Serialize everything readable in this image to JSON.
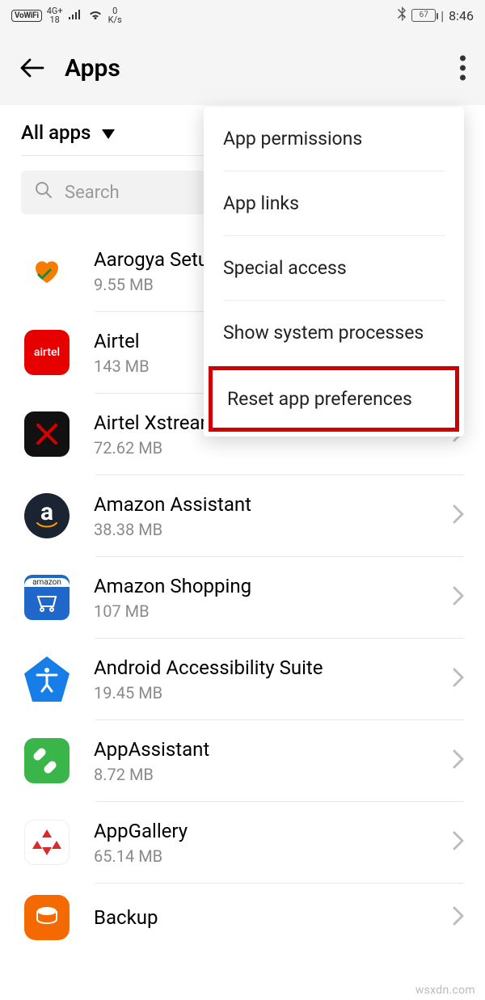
{
  "status": {
    "vowifi": "VoWiFi",
    "net_label": "4G+",
    "net_sub": "18",
    "speed_top": "0",
    "speed_unit": "K/s",
    "battery": "67",
    "time": "8:46"
  },
  "header": {
    "title": "Apps"
  },
  "filter": {
    "label": "All apps"
  },
  "search": {
    "placeholder": "Search"
  },
  "menu": {
    "items": [
      "App permissions",
      "App links",
      "Special access",
      "Show system processes",
      "Reset app preferences"
    ]
  },
  "apps": [
    {
      "name": "Aarogya Setu",
      "size": "9.55 MB",
      "icon": "aarogya-icon"
    },
    {
      "name": "Airtel",
      "size": "143 MB",
      "icon": "airtel-icon"
    },
    {
      "name": "Airtel Xstream",
      "size": "72.62 MB",
      "icon": "xstream-icon"
    },
    {
      "name": "Amazon Assistant",
      "size": "38.38 MB",
      "icon": "amazon-assistant-icon"
    },
    {
      "name": "Amazon Shopping",
      "size": "107 MB",
      "icon": "amazon-shopping-icon"
    },
    {
      "name": "Android Accessibility Suite",
      "size": "19.45 MB",
      "icon": "accessibility-icon"
    },
    {
      "name": "AppAssistant",
      "size": "8.72 MB",
      "icon": "app-assistant-icon"
    },
    {
      "name": "AppGallery",
      "size": "65.14 MB",
      "icon": "app-gallery-icon"
    },
    {
      "name": "Backup",
      "size": "",
      "icon": "backup-icon"
    }
  ],
  "watermark": "wsxdn.com"
}
